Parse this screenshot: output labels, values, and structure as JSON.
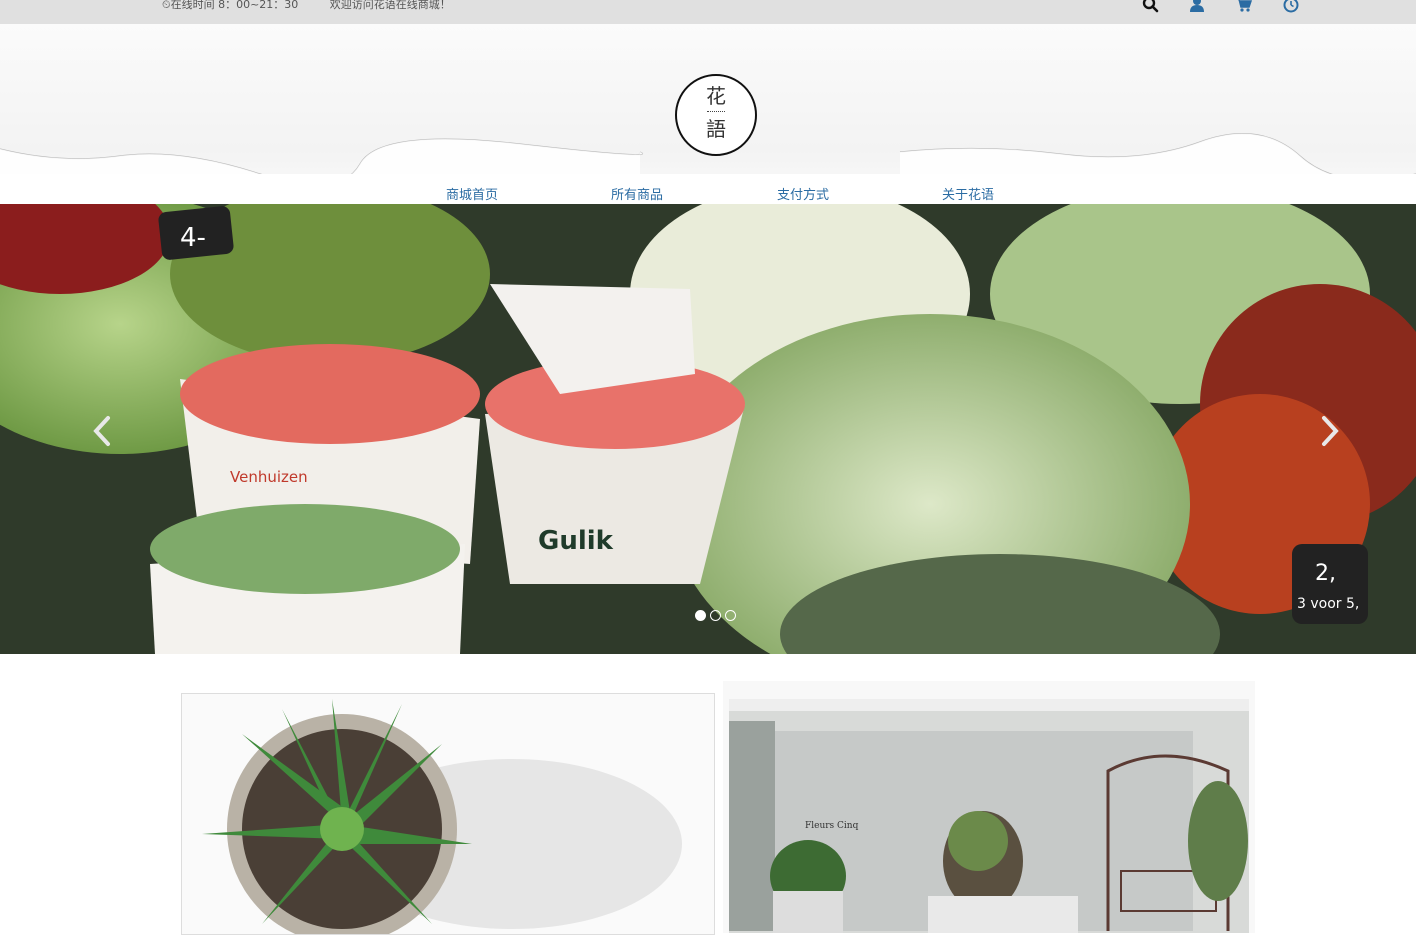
{
  "topbar": {
    "hours": "⏲在线时间 8：00~21：30",
    "welcome": "欢迎访问花语在线商城！",
    "icons": [
      "search-icon",
      "user-icon",
      "cart-icon",
      "clock-icon"
    ]
  },
  "logo": {
    "char_top": "花",
    "char_bottom": "語"
  },
  "nav": {
    "items": [
      {
        "label": "商城首页"
      },
      {
        "label": "所有商品"
      },
      {
        "label": "支付方式"
      },
      {
        "label": "关于花语"
      }
    ]
  },
  "carousel": {
    "prev_icon": "chevron-left-icon",
    "next_icon": "chevron-right-icon",
    "slide_count": 3,
    "active_index": 0,
    "photo_texts": [
      "4-",
      "Gulik",
      "Venhuizen",
      "2,",
      "3 voor 5,"
    ]
  },
  "products": {
    "cards": [
      {
        "subject": "succulent plant in pot"
      },
      {
        "subject": "flower shop storefront",
        "sign": "Fleurs Cinq"
      }
    ]
  },
  "colors": {
    "topbar_bg": "#e0e0e0",
    "nav_link": "#2b6ca3",
    "icon_blue": "#2b6ca3"
  }
}
